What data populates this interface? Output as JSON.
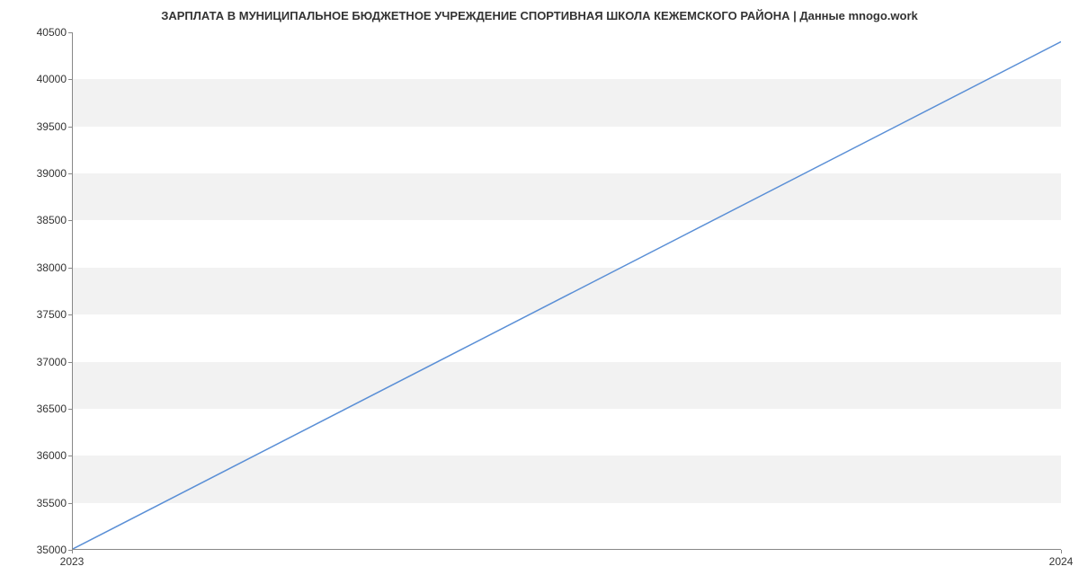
{
  "chart_data": {
    "type": "line",
    "title": "ЗАРПЛАТА В МУНИЦИПАЛЬНОЕ БЮДЖЕТНОЕ УЧРЕЖДЕНИЕ СПОРТИВНАЯ ШКОЛА КЕЖЕМСКОГО РАЙОНА | Данные mnogo.work",
    "x": [
      2023,
      2024
    ],
    "values": [
      35000,
      40400
    ],
    "xlabel": "",
    "ylabel": "",
    "xlim": [
      2023,
      2024
    ],
    "ylim": [
      35000,
      40500
    ],
    "x_ticks": [
      2023,
      2024
    ],
    "y_ticks": [
      35000,
      35500,
      36000,
      36500,
      37000,
      37500,
      38000,
      38500,
      39000,
      39500,
      40000,
      40500
    ],
    "line_color": "#5a8fd6"
  }
}
